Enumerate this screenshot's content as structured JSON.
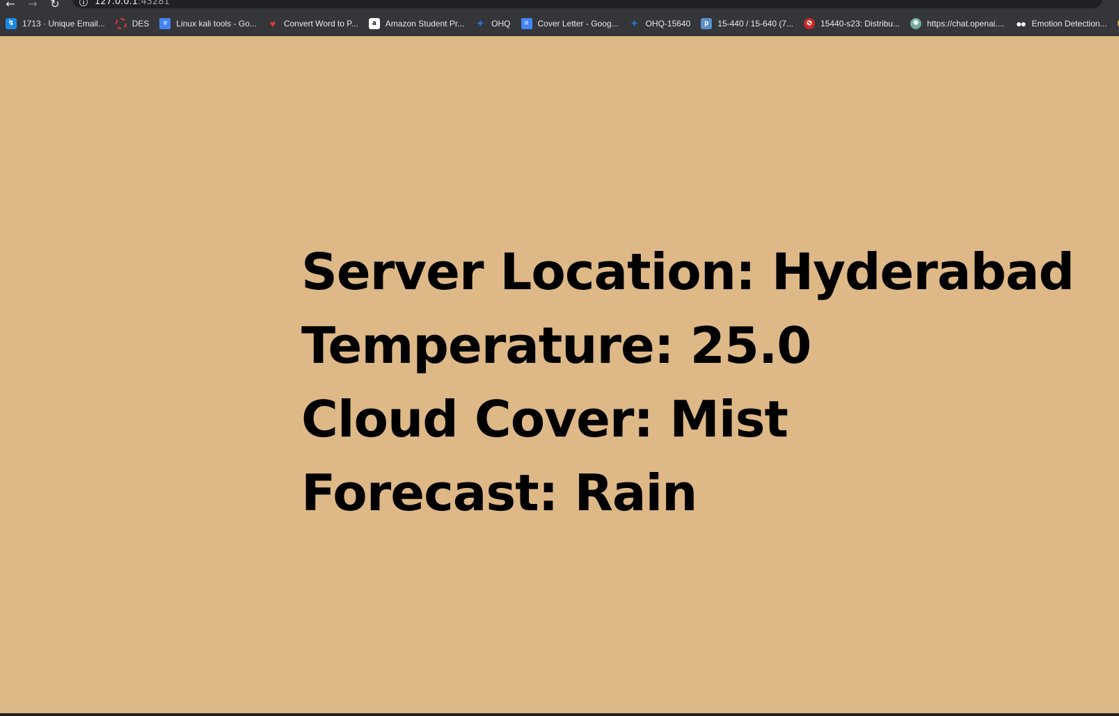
{
  "browser": {
    "url_host": "127.0.0.1",
    "url_port": ":43281",
    "bookmarks": [
      {
        "label": "1713 · Unique Email...",
        "icon": "leetcode-icon"
      },
      {
        "label": "DES",
        "icon": "des-icon"
      },
      {
        "label": "Linux kali tools - Go...",
        "icon": "google-docs-icon"
      },
      {
        "label": "Convert Word to P...",
        "icon": "heart-icon"
      },
      {
        "label": "Amazon Student Pr...",
        "icon": "amazon-icon"
      },
      {
        "label": "OHQ",
        "icon": "ohq-icon"
      },
      {
        "label": "Cover Letter - Goog...",
        "icon": "google-docs-icon"
      },
      {
        "label": "OHQ-15640",
        "icon": "ohq-icon"
      },
      {
        "label": "15-440 / 15-640 (7...",
        "icon": "piazza-icon"
      },
      {
        "label": "15440-s23: Distribu...",
        "icon": "blocked-icon"
      },
      {
        "label": "https://chat.openai....",
        "icon": "chatgpt-icon"
      },
      {
        "label": "Emotion Detection...",
        "icon": "medium-icon"
      }
    ]
  },
  "weather": {
    "server_location": "Server Location: Hyderabad",
    "temperature": "Temperature: 25.0",
    "cloud_cover": "Cloud Cover: Mist",
    "forecast": "Forecast: Rain"
  },
  "colors": {
    "page_background": "#deb887",
    "text": "#000000",
    "toolbar": "#35363a"
  }
}
